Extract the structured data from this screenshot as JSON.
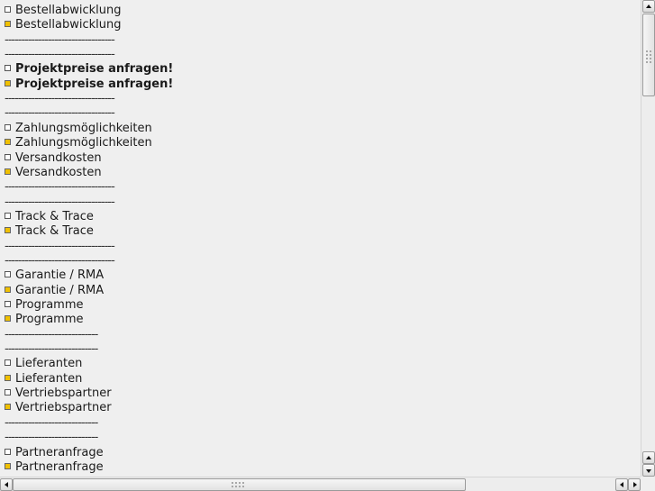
{
  "rows": [
    {
      "type": "item",
      "label": "Bestellabwicklung",
      "selected": false,
      "bold": false
    },
    {
      "type": "item",
      "label": "Bestellabwicklung",
      "selected": true,
      "bold": false
    },
    {
      "type": "sep",
      "text": "---------------------------------"
    },
    {
      "type": "sep",
      "text": "---------------------------------"
    },
    {
      "type": "item",
      "label": "Projektpreise anfragen!",
      "selected": false,
      "bold": true
    },
    {
      "type": "item",
      "label": "Projektpreise anfragen!",
      "selected": true,
      "bold": true
    },
    {
      "type": "sep",
      "text": "---------------------------------"
    },
    {
      "type": "sep",
      "text": "---------------------------------"
    },
    {
      "type": "item",
      "label": "Zahlungsmöglichkeiten",
      "selected": false,
      "bold": false
    },
    {
      "type": "item",
      "label": "Zahlungsmöglichkeiten",
      "selected": true,
      "bold": false
    },
    {
      "type": "item",
      "label": "Versandkosten",
      "selected": false,
      "bold": false
    },
    {
      "type": "item",
      "label": "Versandkosten",
      "selected": true,
      "bold": false
    },
    {
      "type": "sep",
      "text": "---------------------------------"
    },
    {
      "type": "sep",
      "text": "---------------------------------"
    },
    {
      "type": "item",
      "label": "Track & Trace",
      "selected": false,
      "bold": false
    },
    {
      "type": "item",
      "label": "Track & Trace",
      "selected": true,
      "bold": false
    },
    {
      "type": "sep",
      "text": "---------------------------------"
    },
    {
      "type": "sep",
      "text": "---------------------------------"
    },
    {
      "type": "item",
      "label": "Garantie / RMA",
      "selected": false,
      "bold": false
    },
    {
      "type": "item",
      "label": "Garantie / RMA",
      "selected": true,
      "bold": false
    },
    {
      "type": "item",
      "label": "Programme",
      "selected": false,
      "bold": false
    },
    {
      "type": "item",
      "label": "Programme",
      "selected": true,
      "bold": false
    },
    {
      "type": "sep",
      "text": "----------------------------"
    },
    {
      "type": "sep",
      "text": "----------------------------"
    },
    {
      "type": "item",
      "label": "Lieferanten",
      "selected": false,
      "bold": false
    },
    {
      "type": "item",
      "label": "Lieferanten",
      "selected": true,
      "bold": false
    },
    {
      "type": "item",
      "label": "Vertriebspartner",
      "selected": false,
      "bold": false
    },
    {
      "type": "item",
      "label": "Vertriebspartner",
      "selected": true,
      "bold": false
    },
    {
      "type": "sep",
      "text": "----------------------------"
    },
    {
      "type": "sep",
      "text": "----------------------------"
    },
    {
      "type": "item",
      "label": "Partneranfrage",
      "selected": false,
      "bold": false
    },
    {
      "type": "item",
      "label": "Partneranfrage",
      "selected": true,
      "bold": false
    }
  ],
  "colors": {
    "selected_bullet": "#f0c000",
    "background": "#efefef"
  },
  "scrollbars": {
    "vertical": {
      "icons": [
        "arrow-up-icon",
        "arrow-down-icon"
      ]
    },
    "horizontal": {
      "icons": [
        "arrow-left-icon",
        "arrow-right-icon"
      ]
    }
  }
}
